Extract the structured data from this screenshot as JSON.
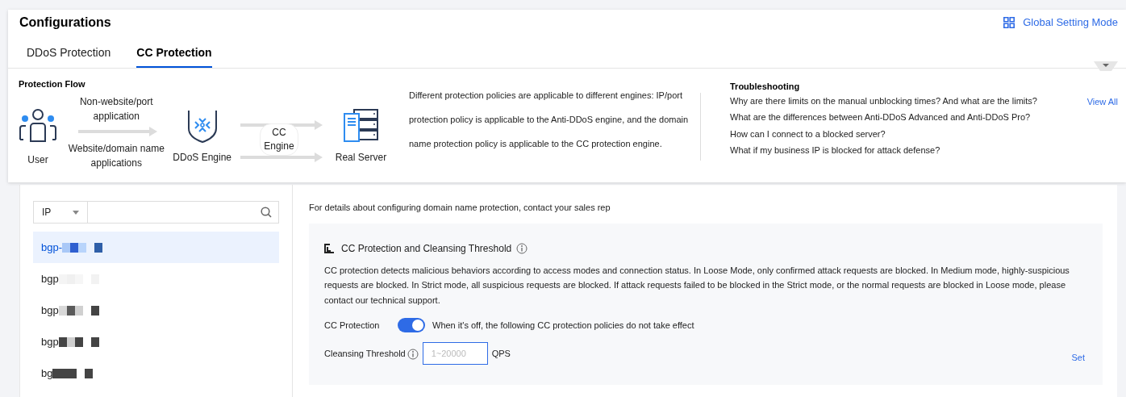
{
  "header": {
    "title": "Configurations",
    "mode_link": "Global Setting Mode"
  },
  "tabs": [
    {
      "label": "DDoS Protection",
      "selected": false
    },
    {
      "label": "CC Protection",
      "selected": true
    }
  ],
  "protection_flow": {
    "title": "Protection Flow",
    "user": "User",
    "upper_route": "Non-website/port application",
    "lower_route": "Website/domain name applications",
    "ddos_engine": "DDoS Engine",
    "cc_engine": "CC Engine",
    "real_server": "Real Server",
    "description": "Different protection policies are applicable to different engines: IP/port protection policy is applicable to the Anti-DDoS engine, and the domain name protection policy is applicable to the CC protection engine."
  },
  "troubleshooting": {
    "title": "Troubleshooting",
    "view_all": "View All",
    "questions": [
      "Why are there limits on the manual unblocking times? And what are the limits?",
      "What are the differences between Anti-DDoS Advanced and Anti-DDoS Pro?",
      "How can I connect to a blocked server?",
      "What if my business IP is blocked for attack defense?"
    ]
  },
  "resource_list": {
    "filter": "IP",
    "items": [
      {
        "label": "bgp-",
        "selected": true
      },
      {
        "label": "bgp",
        "selected": false
      },
      {
        "label": "bgp",
        "selected": false
      },
      {
        "label": "bgp",
        "selected": false
      },
      {
        "label": "bg",
        "selected": false
      }
    ]
  },
  "notice": "For details about configuring domain name protection, contact your sales rep",
  "cc_section": {
    "title": "CC Protection and Cleansing Threshold",
    "description": "CC protection detects malicious behaviors according to access modes and connection status. In Loose Mode, only confirmed attack requests are blocked. In Medium mode, highly-suspicious requests are blocked. In Strict mode, all suspicious requests are blocked. If attack requests failed to be blocked in the Strict mode, or the normal requests are blocked in Loose mode, please contact our technical support.",
    "protection_label": "CC Protection",
    "protection_on": true,
    "protection_hint": "When it's off, the following CC protection policies do not take effect",
    "threshold_label": "Cleansing Threshold",
    "threshold_placeholder": "1~20000",
    "threshold_unit": "QPS",
    "set": "Set"
  }
}
